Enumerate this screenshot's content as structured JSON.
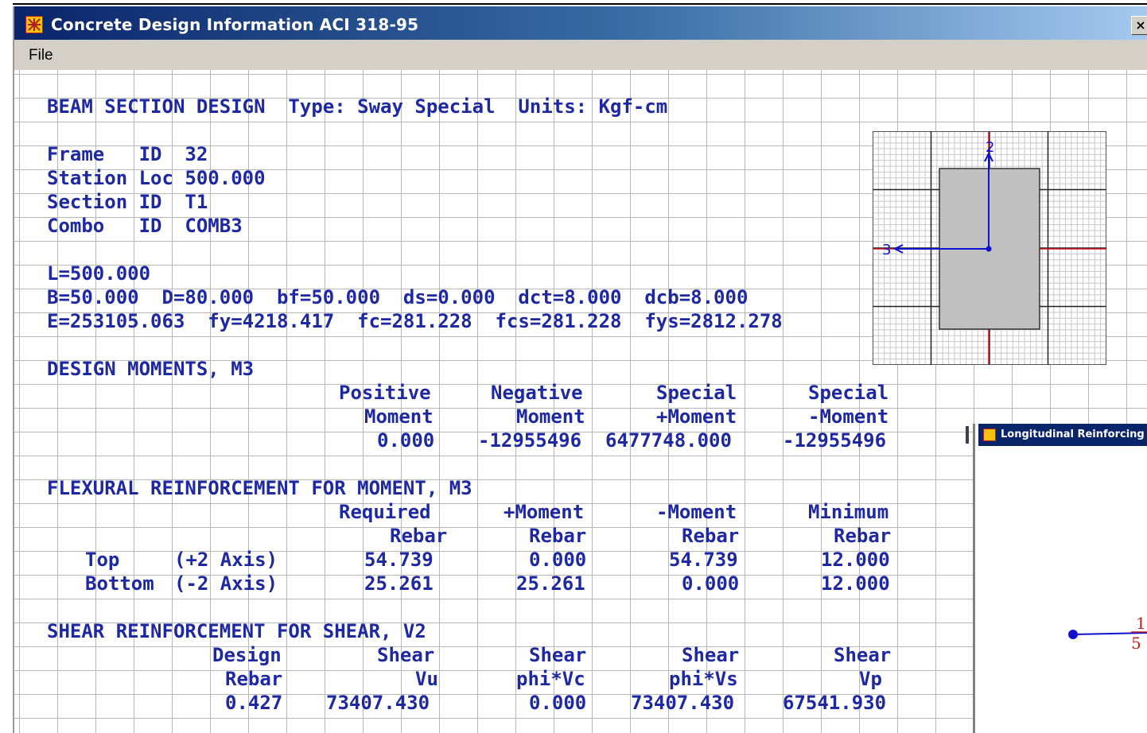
{
  "window": {
    "title": "Concrete Design Information  ACI 318-95",
    "close_label": "×",
    "icon": "sap2000-app-icon"
  },
  "menu": {
    "items": [
      "File"
    ]
  },
  "report": {
    "heading": "BEAM SECTION DESIGN  Type: Sway Special  Units: Kgf-cm",
    "info_lines": [
      "Frame   ID  32",
      "Station Loc 500.000",
      "Section ID  T1",
      "Combo   ID  COMB3"
    ],
    "geometry_lines": [
      "L=500.000",
      "B=50.000  D=80.000  bf=50.000  ds=0.000  dct=8.000  dcb=8.000",
      "E=253105.063  fy=4218.417  fc=281.228  fcs=281.228  fys=2812.278"
    ],
    "moments": {
      "title": "DESIGN MOMENTS, M3",
      "headers_1": [
        "Positive",
        "Negative",
        "Special",
        "Special"
      ],
      "headers_2": [
        "Moment",
        "Moment",
        "+Moment",
        "-Moment"
      ],
      "values": [
        "0.000",
        "-12955496",
        "6477748.000",
        "-12955496"
      ]
    },
    "flexural": {
      "title": "FLEXURAL REINFORCEMENT FOR MOMENT, M3",
      "headers_1": [
        "Required",
        "+Moment",
        "-Moment",
        "Minimum"
      ],
      "headers_2": [
        "Rebar",
        "Rebar",
        "Rebar",
        "Rebar"
      ],
      "rows": [
        {
          "label": "Top",
          "axis": "(+2 Axis)",
          "values": [
            "54.739",
            "0.000",
            "54.739",
            "12.000"
          ]
        },
        {
          "label": "Bottom",
          "axis": "(-2 Axis)",
          "values": [
            "25.261",
            "25.261",
            "0.000",
            "12.000"
          ]
        }
      ]
    },
    "shear": {
      "title": "SHEAR REINFORCEMENT FOR SHEAR, V2",
      "headers_1": [
        "Design",
        "Shear",
        "Shear",
        "Shear",
        "Shear"
      ],
      "headers_2": [
        "Rebar",
        "Vu",
        "phi*Vc",
        "phi*Vs",
        "Vp"
      ],
      "values": [
        "0.427",
        "73407.430",
        "0.000",
        "73407.430",
        "67541.930"
      ]
    }
  },
  "section_diagram": {
    "axis_2_label": "2",
    "axis_3_label": "3",
    "colors": {
      "section_fill": "#c0c0c0",
      "axis": "#1010d0",
      "reference": "#d01020"
    }
  },
  "child_window": {
    "title": "Longitudinal Reinforcing",
    "labels": [
      "1",
      "5"
    ]
  },
  "colors": {
    "report_text": "#1e28a0",
    "grid": "#b8b8b8",
    "title_bar": "#0a246a"
  }
}
